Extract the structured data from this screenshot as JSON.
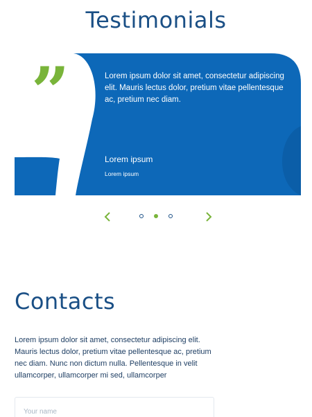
{
  "testimonials": {
    "title": "Testimonials",
    "quote_text": "Lorem ipsum dolor sit amet, consectetur adipiscing elit. Mauris lectus dolor, pretium vitae pellentesque ac, pretium nec diam.",
    "author_name": "Lorem ipsum",
    "author_role": "Lorem ipsum",
    "card_color": "#0d68b8",
    "quote_color": "#79b43a",
    "carousel": {
      "slide_count": 3,
      "active_index": 1,
      "prev_icon": "chevron-left-icon",
      "next_icon": "chevron-right-icon"
    }
  },
  "contacts": {
    "title": "Contacts",
    "description": "Lorem ipsum dolor sit amet, consectetur adipiscing elit. Mauris lectus dolor, pretium vitae pellentesque ac, pretium nec diam. Nunc non dictum nulla. Pellentesque in velit ullamcorper, ullamcorper mi sed, ullamcorper",
    "name_input": {
      "value": "",
      "placeholder": "Your name"
    }
  }
}
